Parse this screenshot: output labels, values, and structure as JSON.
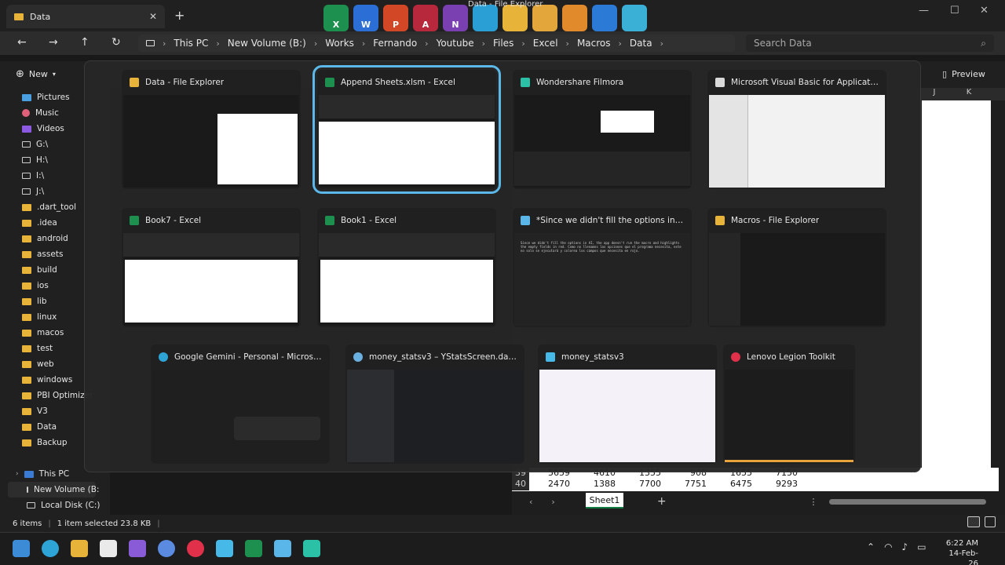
{
  "explorer": {
    "tab_title": "Data",
    "close_glyph": "✕",
    "new_tab_glyph": "+",
    "breadcrumb": [
      "This PC",
      "New Volume (B:)",
      "Works",
      "Fernando",
      "Youtube",
      "Files",
      "Excel",
      "Macros",
      "Data"
    ],
    "breadcrumb_sep": "›",
    "search_placeholder": "Search Data",
    "new_label": "New",
    "preview_label": "Preview",
    "sidebar": [
      "Pictures",
      "Music",
      "Videos",
      "G:\\",
      "H:\\",
      "I:\\",
      "J:\\",
      ".dart_tool",
      ".idea",
      "android",
      "assets",
      "build",
      "ios",
      "lib",
      "linux",
      "macos",
      "test",
      "web",
      "windows",
      "PBI Optimizer",
      "V3",
      "Data",
      "Backup"
    ],
    "sidebar_icons": [
      "pictures-icon",
      "music-icon",
      "videos-icon",
      "drive-icon",
      "drive-icon",
      "drive-icon",
      "drive-icon",
      "folder-icon",
      "folder-icon",
      "folder-icon",
      "folder-icon",
      "folder-icon",
      "folder-icon",
      "folder-icon",
      "folder-icon",
      "folder-icon",
      "folder-icon",
      "folder-icon",
      "folder-icon",
      "folder-icon",
      "folder-icon",
      "folder-icon",
      "folder-icon"
    ],
    "this_pc": "This PC",
    "new_volume": "New Volume (B:",
    "local_disk": "Local Disk (C:)",
    "status_items": "6 items",
    "status_selected": "1 item selected  23.8 KB"
  },
  "dock": {
    "title": "Data - File Explorer",
    "apps": [
      {
        "name": "excel",
        "letter": "X",
        "color": "#1d8f4f"
      },
      {
        "name": "word",
        "letter": "W",
        "color": "#2b6fd6"
      },
      {
        "name": "powerpoint",
        "letter": "P",
        "color": "#d24726"
      },
      {
        "name": "access",
        "letter": "A",
        "color": "#b7283c"
      },
      {
        "name": "onenote",
        "letter": "N",
        "color": "#7a3fb0"
      },
      {
        "name": "desktop",
        "letter": "",
        "color": "#2a9fd6"
      },
      {
        "name": "folder",
        "letter": "",
        "color": "#e8b339"
      },
      {
        "name": "ladder",
        "letter": "",
        "color": "#e2a63a"
      },
      {
        "name": "tools",
        "letter": "",
        "color": "#e08a2c"
      },
      {
        "name": "devtools",
        "letter": "",
        "color": "#2a7ad6"
      },
      {
        "name": "recycle-bin",
        "letter": "",
        "color": "#3ab0d6"
      }
    ]
  },
  "switcher": {
    "windows": [
      {
        "title": "Data - File Explorer",
        "icon": "folder-icon",
        "color": "#e8b339"
      },
      {
        "title": "Append Sheets.xlsm - Excel",
        "icon": "excel-icon",
        "color": "#1d8f4f"
      },
      {
        "title": "Wondershare Filmora",
        "icon": "filmora-icon",
        "color": "#2bc1a6"
      },
      {
        "title": "Microsoft Visual Basic for Applications - ...",
        "icon": "vba-icon",
        "color": "#d9d9d9"
      },
      {
        "title": "Book7 - Excel",
        "icon": "excel-icon",
        "color": "#1d8f4f"
      },
      {
        "title": "Book1 - Excel",
        "icon": "excel-icon",
        "color": "#1d8f4f"
      },
      {
        "title": "*Since we didn't fill the options in - Not...",
        "icon": "notepad-icon",
        "color": "#5ab6e8"
      },
      {
        "title": "Macros - File Explorer",
        "icon": "folder-icon",
        "color": "#e8b339"
      },
      {
        "title": "Google Gemini - Personal - Microsoft E...",
        "icon": "edge-icon",
        "color": "#2da3d6"
      },
      {
        "title": "money_statsv3 – YStatsScreen.dart [mo...",
        "icon": "android-studio-icon",
        "color": "#6ab0e0"
      },
      {
        "title": "money_statsv3",
        "icon": "flutter-icon",
        "color": "#46b9e8"
      },
      {
        "title": "Lenovo Legion Toolkit",
        "icon": "legion-icon",
        "color": "#e0304a"
      }
    ],
    "notepad_text": "Since we didn't fill the options in AI, the app doesn't run the macro and highlights the empty fields in red. Como no llenamos las opciones que el programa necesita, este no solo se ejecutará y colorea los campos que necesita en rojo."
  },
  "excel": {
    "columns": [
      "J",
      "K"
    ],
    "row39": {
      "num": "39",
      "cells": [
        "5659",
        "4610",
        "1355",
        "908",
        "1655",
        "7150"
      ]
    },
    "row40": {
      "num": "40",
      "cells": [
        "2470",
        "1388",
        "7700",
        "7751",
        "6475",
        "9293"
      ]
    },
    "sheet_name": "Sheet1"
  },
  "taskbar": {
    "time": "6:22 AM",
    "date": "14-Feb-26",
    "apps": [
      {
        "name": "start",
        "color": "#3b8bd6"
      },
      {
        "name": "edge",
        "color": "#2da3d6"
      },
      {
        "name": "file-explorer",
        "color": "#e8b339"
      },
      {
        "name": "store",
        "color": "#eaeaea"
      },
      {
        "name": "visual-studio",
        "color": "#8a5bd6"
      },
      {
        "name": "app-star",
        "color": "#5a8be0"
      },
      {
        "name": "legion",
        "color": "#e0304a"
      },
      {
        "name": "flutter",
        "color": "#46b9e8"
      },
      {
        "name": "excel",
        "color": "#1d8f4f"
      },
      {
        "name": "notepad",
        "color": "#5ab6e8"
      },
      {
        "name": "filmora",
        "color": "#2bc1a6"
      }
    ]
  }
}
